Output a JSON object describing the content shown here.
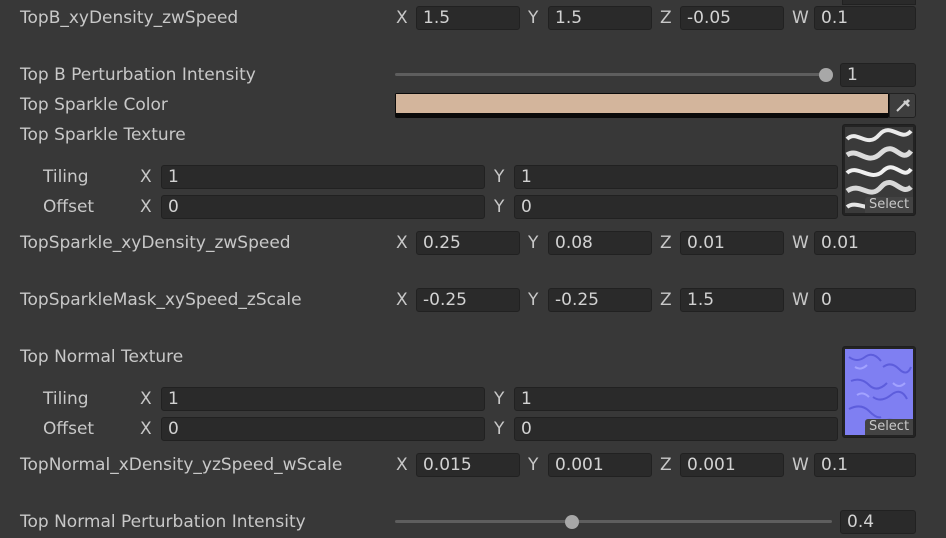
{
  "top_b_xy": {
    "label": "TopB_xyDensity_zwSpeed",
    "x": "1.5",
    "y": "1.5",
    "z": "-0.05",
    "w": "0.1"
  },
  "top_b_perturb": {
    "label": "Top B Perturbation Intensity",
    "value": "1",
    "fraction": 1.0
  },
  "top_sparkle_color": {
    "label": "Top Sparkle Color",
    "color": "#d3b59c"
  },
  "top_sparkle_texture": {
    "label": "Top Sparkle Texture",
    "tiling": {
      "label": "Tiling",
      "x": "1",
      "y": "1"
    },
    "offset": {
      "label": "Offset",
      "x": "0",
      "y": "0"
    },
    "select_label": "Select",
    "thumb_colors": [
      "#2a2a2a",
      "#e8e8e8"
    ]
  },
  "top_sparkle_xy": {
    "label": "TopSparkle_xyDensity_zwSpeed",
    "x": "0.25",
    "y": "0.08",
    "z": "0.01",
    "w": "0.01"
  },
  "top_sparkle_mask": {
    "label": "TopSparkleMask_xySpeed_zScale",
    "x": "-0.25",
    "y": "-0.25",
    "z": "1.5",
    "w": "0"
  },
  "top_normal_texture": {
    "label": "Top Normal Texture",
    "tiling": {
      "label": "Tiling",
      "x": "1",
      "y": "1"
    },
    "offset": {
      "label": "Offset",
      "x": "0",
      "y": "0"
    },
    "select_label": "Select",
    "thumb_colors": [
      "#7f7ff2",
      "#5a5ae0"
    ]
  },
  "top_normal_xy": {
    "label": "TopNormal_xDensity_yzSpeed_wScale",
    "x": "0.015",
    "y": "0.001",
    "z": "0.001",
    "w": "0.1"
  },
  "top_normal_perturb": {
    "label": "Top Normal Perturbation Intensity",
    "value": "0.4",
    "fraction": 0.4
  },
  "axes": {
    "x": "X",
    "y": "Y",
    "z": "Z",
    "w": "W"
  },
  "icons": {
    "eyedropper": "eyedropper-icon"
  }
}
